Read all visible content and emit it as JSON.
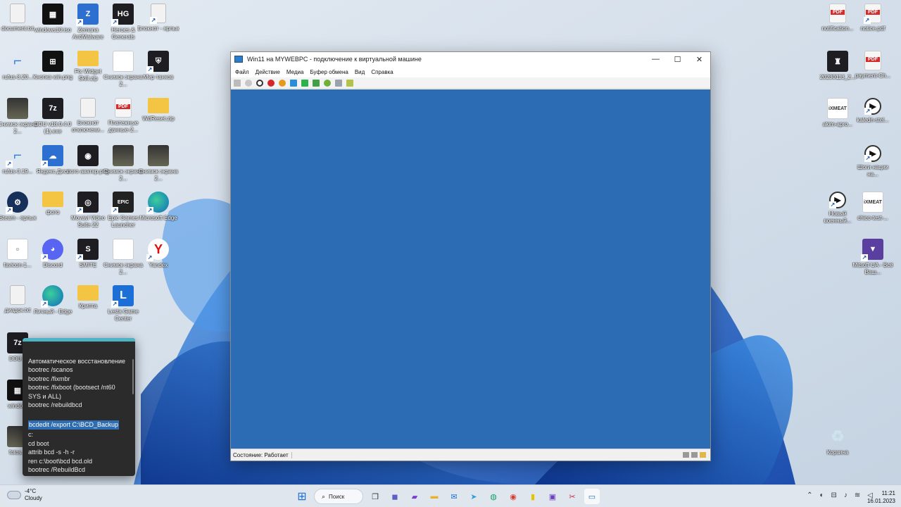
{
  "desktop": {
    "icons": [
      {
        "label": "document.txt",
        "kind": "doc",
        "glyph": ""
      },
      {
        "label": "windows10.iso",
        "kind": "win",
        "glyph": "▦"
      },
      {
        "label": "Zemana AntiMalware",
        "kind": "blue",
        "glyph": "Z"
      },
      {
        "label": "Heroes & Generals",
        "kind": "dark",
        "glyph": "HG"
      },
      {
        "label": "Блокнот - ярлык",
        "kind": "doc",
        "glyph": ""
      },
      {
        "label": "rufus-3.20...",
        "kind": "usb",
        "glyph": "⌐"
      },
      {
        "label": "Кнопка win.png",
        "kind": "win",
        "glyph": "⊞"
      },
      {
        "label": "Fix Widget Skill.zip",
        "kind": "folder",
        "glyph": ""
      },
      {
        "label": "Снимок экрана 2...",
        "kind": "white",
        "glyph": ""
      },
      {
        "label": "Мир танков",
        "kind": "dark",
        "glyph": "⛨"
      },
      {
        "label": "Снимок экрана 2...",
        "kind": "img",
        "glyph": ""
      },
      {
        "label": "DDU v18.0.4.0 (1).exe",
        "kind": "dark",
        "glyph": "7z"
      },
      {
        "label": "Блокнот отключени...",
        "kind": "doc",
        "glyph": ""
      },
      {
        "label": "Платежные данные-2...",
        "kind": "pdf",
        "glyph": ""
      },
      {
        "label": "WdReset.zip",
        "kind": "folder",
        "glyph": ""
      },
      {
        "label": "rufus-3.19...",
        "kind": "usb",
        "glyph": "⌐"
      },
      {
        "label": "Яндекс.Диск",
        "kind": "blue",
        "glyph": "☁"
      },
      {
        "label": "лого аватар.png",
        "kind": "dark",
        "glyph": "◉"
      },
      {
        "label": "Снимок экрана 2...",
        "kind": "img",
        "glyph": ""
      },
      {
        "label": "Снимок экрана 2...",
        "kind": "img",
        "glyph": ""
      },
      {
        "label": "Steam - ярлык",
        "kind": "steam",
        "glyph": "⚙"
      },
      {
        "label": "фото",
        "kind": "folder",
        "glyph": ""
      },
      {
        "label": "Movavi Video Suite 22",
        "kind": "dark",
        "glyph": "◎"
      },
      {
        "label": "Epic Games Launcher",
        "kind": "epic",
        "glyph": "EPIC"
      },
      {
        "label": "Microsoft Edge",
        "kind": "edge",
        "glyph": ""
      },
      {
        "label": "favicon-1...",
        "kind": "white",
        "glyph": "☺"
      },
      {
        "label": "Discord",
        "kind": "discord",
        "glyph": "◕"
      },
      {
        "label": "SMITE",
        "kind": "dark",
        "glyph": "S"
      },
      {
        "label": "Снимок экрана 2...",
        "kind": "white",
        "glyph": ""
      },
      {
        "label": "Yandex",
        "kind": "yandex",
        "glyph": "Y"
      },
      {
        "label": "диадок.txt",
        "kind": "doc",
        "glyph": ""
      },
      {
        "label": "Личный - Edge",
        "kind": "edge",
        "glyph": ""
      },
      {
        "label": "Крипта",
        "kind": "folder",
        "glyph": ""
      },
      {
        "label": "Lesta Game Center",
        "kind": "lcenter",
        "glyph": "L"
      },
      {
        "label": "DDU...",
        "kind": "dark",
        "glyph": "7z"
      },
      {
        "label": "windo...",
        "kind": "win",
        "glyph": "▦"
      },
      {
        "label": "fotos...",
        "kind": "img",
        "glyph": ""
      },
      {
        "label": "notification...",
        "kind": "pdf",
        "glyph": ""
      },
      {
        "label": "notice.pdf",
        "kind": "pdf",
        "glyph": ""
      },
      {
        "label": "20230113_2...",
        "kind": "dark",
        "glyph": "♜"
      },
      {
        "label": "payment-Ch...",
        "kind": "pdf",
        "glyph": ""
      },
      {
        "label": "akim-apro...",
        "kind": "white",
        "glyph": "iXMEAT"
      },
      {
        "label": "kaledn-stel...",
        "kind": "video",
        "glyph": "▶"
      },
      {
        "label": "Шоги нации на...",
        "kind": "video",
        "glyph": "▶"
      },
      {
        "label": "Новый военный...",
        "kind": "video",
        "glyph": "▶"
      },
      {
        "label": "chico-test-...",
        "kind": "white",
        "glyph": "iXMEAT"
      },
      {
        "label": "Mitsoft UA - Всё Ваш...",
        "kind": "purple",
        "glyph": "▼"
      },
      {
        "label": "Корзина",
        "kind": "recycle",
        "glyph": "♻"
      }
    ]
  },
  "vm_window": {
    "title": "Win11 на MYWEBPC - подключение к виртуальной машине",
    "menus": [
      "Файл",
      "Действие",
      "Медиа",
      "Буфер обмена",
      "Вид",
      "Справка"
    ],
    "status": "Состояние: Работает",
    "screen_color": "#2b6cb5"
  },
  "notes": {
    "lines": [
      "Автоматическое восстановление",
      "bootrec /scanos",
      "bootrec /fixmbr",
      "bootrec /fixboot (bootsect /nt60",
      "SYS и ALL)",
      "bootrec /rebuildbcd"
    ],
    "highlighted": "bcdedit /export C:\\BCD_Backup",
    "lines_after": [
      "c:",
      "cd boot",
      "attrib bcd -s -h -r",
      "ren c:\\boot\\bcd bcd.old",
      "bootrec /RebuildBcd"
    ]
  },
  "taskbar": {
    "weather_temp": "-4°C",
    "weather_desc": "Cloudy",
    "search_label": "Поиск",
    "time": "11:21",
    "date": "16.01.2023"
  }
}
